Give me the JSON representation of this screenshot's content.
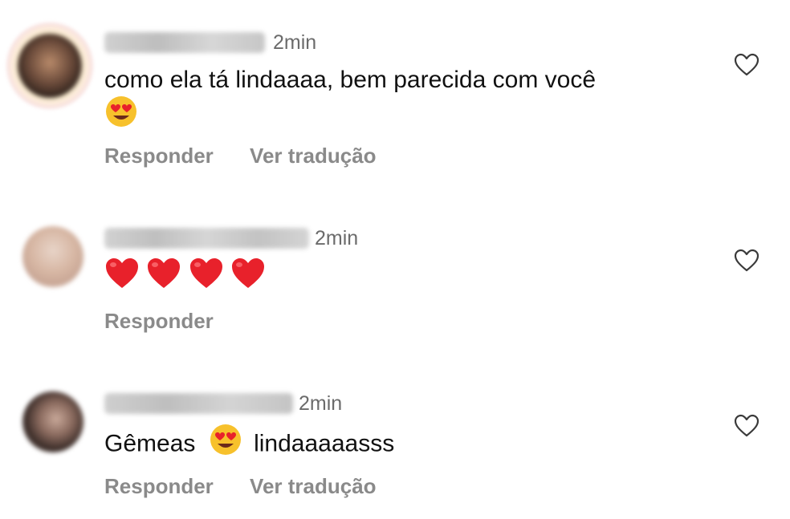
{
  "comments": [
    {
      "time": "2min",
      "text": "como ela tá lindaaaa, bem parecida com você",
      "actions": [
        "Responder",
        "Ver tradução"
      ]
    },
    {
      "time": "2min",
      "text": "",
      "red_hearts": 4,
      "actions": [
        "Responder"
      ]
    },
    {
      "time": "2min",
      "text_before": "Gêmeas",
      "text_after": "lindaaaaasss",
      "actions": [
        "Responder",
        "Ver tradução"
      ]
    }
  ],
  "icons": {
    "like": "heart-outline-icon",
    "emoji_eyes": "heart-eyes-emoji",
    "emoji_heart": "red-heart-emoji"
  },
  "colors": {
    "text": "#111111",
    "muted": "#8a8a8a",
    "time": "#6b6b6b",
    "heart_red": "#e8212b",
    "emoji_yellow": "#f7c12c"
  }
}
